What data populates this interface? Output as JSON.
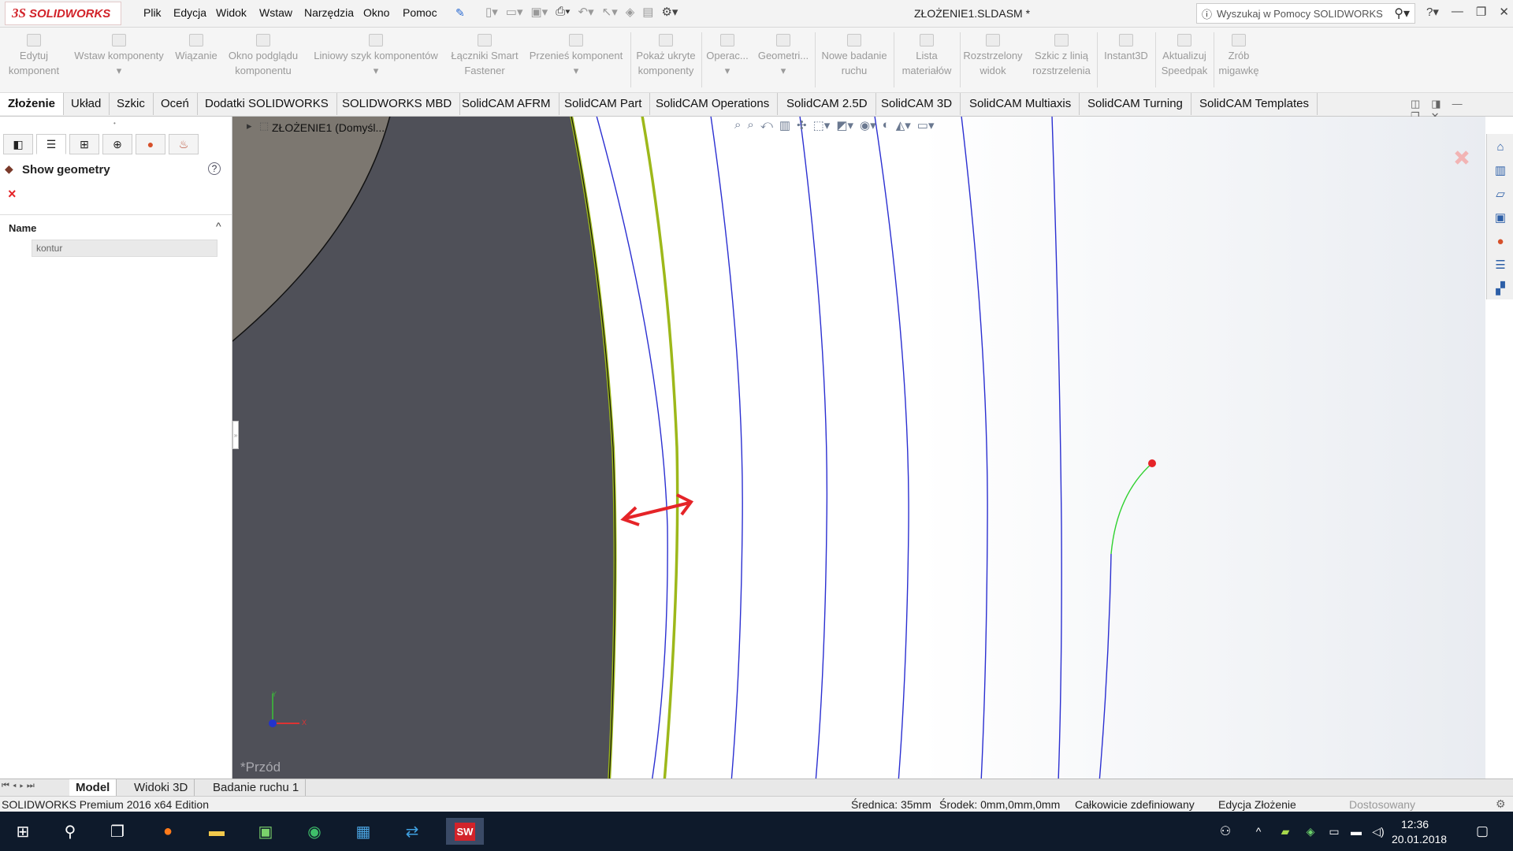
{
  "app": {
    "logo_prefix": "3S",
    "logo_text": "SOLIDWORKS",
    "doc_title": "ZŁOŻENIE1.SLDASM *"
  },
  "menu": [
    "Plik",
    "Edycja",
    "Widok",
    "Wstaw",
    "Narzędzia",
    "Okno",
    "Pomoc"
  ],
  "help_search": {
    "placeholder": "Wyszukaj w Pomocy SOLIDWORKS"
  },
  "commands": [
    {
      "line1": "Edytuj",
      "line2": "komponent",
      "line3": ""
    },
    {
      "line1": "Wstaw komponenty",
      "line2": "",
      "line3": ""
    },
    {
      "line1": "Wiązanie",
      "line2": "",
      "line3": ""
    },
    {
      "line1": "Okno podglądu",
      "line2": "komponentu",
      "line3": ""
    },
    {
      "line1": "Liniowy szyk komponentów",
      "line2": "",
      "line3": ""
    },
    {
      "line1": "Łączniki Smart",
      "line2": "Fastener",
      "line3": ""
    },
    {
      "line1": "Przenieś komponent",
      "line2": "",
      "line3": ""
    },
    {
      "line1": "Pokaż ukryte",
      "line2": "komponenty",
      "line3": ""
    },
    {
      "line1": "Operac...",
      "line2": "",
      "line3": ""
    },
    {
      "line1": "Geometri...",
      "line2": "",
      "line3": ""
    },
    {
      "line1": "Nowe badanie",
      "line2": "ruchu",
      "line3": ""
    },
    {
      "line1": "Lista",
      "line2": "materiałów",
      "line3": ""
    },
    {
      "line1": "Rozstrzelony",
      "line2": "widok",
      "line3": ""
    },
    {
      "line1": "Szkic z linią",
      "line2": "rozstrzelenia",
      "line3": ""
    },
    {
      "line1": "Instant3D",
      "line2": "",
      "line3": ""
    },
    {
      "line1": "Aktualizuj",
      "line2": "Speedpak",
      "line3": ""
    },
    {
      "line1": "Zrób",
      "line2": "migawkę",
      "line3": ""
    }
  ],
  "tabs": [
    "Złożenie",
    "Układ",
    "Szkic",
    "Oceń",
    "Dodatki SOLIDWORKS",
    "SOLIDWORKS MBD",
    "SolidCAM AFRM",
    "SolidCAM Part",
    "SolidCAM Operations",
    "SolidCAM 2.5D",
    "SolidCAM 3D",
    "SolidCAM Multiaxis",
    "SolidCAM Turning",
    "SolidCAM Templates"
  ],
  "panel": {
    "title": "Show geometry",
    "help": "?",
    "close": "×",
    "section_label": "Name",
    "name_value": "kontur"
  },
  "tree": {
    "root_label": "ZŁOŻENIE1  (Domyśl..."
  },
  "viewport": {
    "view_label": "*Przód",
    "axis_y": "Y",
    "axis_x": "X"
  },
  "bottom_tabs": [
    "Model",
    "Widoki 3D",
    "Badanie ruchu 1"
  ],
  "status": {
    "left": "SOLIDWORKS Premium 2016 x64 Edition",
    "diameter": "Średnica: 35mm",
    "center": "Środek: 0mm,0mm,0mm",
    "defined": "Całkowicie zdefiniowany",
    "mode": "Edycja Złożenie",
    "custom": "Dostosowany"
  },
  "taskbar": {
    "time": "12:36",
    "date": "20.01.2018"
  },
  "colors": {
    "accent_red": "#e52428",
    "toolpath_blue": "#2b2fd1",
    "contour_yellow": "#9db81a",
    "part_gray": "#4f5058"
  }
}
